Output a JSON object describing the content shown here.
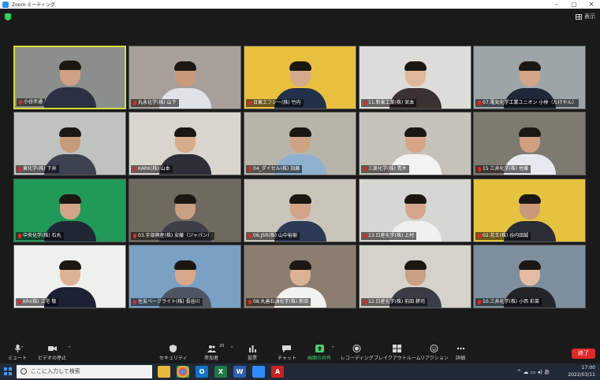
{
  "window": {
    "title": "Zoom ミーティング"
  },
  "view_button": {
    "label": "表示"
  },
  "participants": [
    {
      "name": "小谷幸通",
      "active": true,
      "bg": "#8a8f8d",
      "shirt": "#2a3142",
      "skin": "#cfa284"
    },
    {
      "name": "丸永化学(株) 山下",
      "bg": "#a7a09a",
      "shirt": "#dfe3e8",
      "skin": "#c99a7a"
    },
    {
      "name": "日東エフシー(株) 竹内",
      "bg": "#e8c03e",
      "shirt": "#23304a",
      "skin": "#d4a98c"
    },
    {
      "name": "11.新東工業(株) 宮本",
      "bg": "#dcdcd8",
      "shirt": "#3a3230",
      "skin": "#e0b79b"
    },
    {
      "name": "07.電気化学工業ユニオン 小林（たけやん）",
      "bg": "#9ea5a8",
      "shirt": "#1f2838",
      "skin": "#d3a688"
    },
    {
      "name": "東化学(株) 下井",
      "bg": "#bfc3c0",
      "shirt": "#3d4250",
      "skin": "#c99a7a"
    },
    {
      "name": "KARK(株) 山本",
      "bg": "#d9d4cc",
      "shirt": "#2c2f38",
      "skin": "#d8ab8a"
    },
    {
      "name": "04_ダイセル(株) 加藤",
      "bg": "#b9b4aa",
      "shirt": "#8fb1cf",
      "skin": "#d0a285"
    },
    {
      "name": "三菱化学(株) 青木",
      "bg": "#c5c2ba",
      "shirt": "#f3f3f3",
      "skin": "#d6a587"
    },
    {
      "name": "15 三井化学(株) 佐藤",
      "bg": "#7d7a70",
      "shirt": "#e7e9f0",
      "skin": "#cf9f80"
    },
    {
      "name": "中央化学(株) 石丸",
      "bg": "#1f9a59",
      "shirt": "#1f2735",
      "skin": "#d3a586"
    },
    {
      "name": "03.宇部興産(株) 安藤（ジャパン）",
      "bg": "#6f6a60",
      "shirt": "#3c3f48",
      "skin": "#caa083"
    },
    {
      "name": "06.JSR(株) 山中裕樹",
      "bg": "#c9c5ba",
      "shirt": "#2c3a55",
      "skin": "#d3a586"
    },
    {
      "name": "13.日産化学(株) 上村",
      "bg": "#d6d6d2",
      "shirt": "#f0f0f0",
      "skin": "#d4a78a"
    },
    {
      "name": "02.花王(株) 谷内田誠",
      "bg": "#e6c33f",
      "shirt": "#2a2d36",
      "skin": "#c99a7a"
    },
    {
      "name": "KRI(株) 三宅 敬",
      "bg": "#eef0ee",
      "shirt": "#1c2233",
      "skin": "#dcb194"
    },
    {
      "name": "住友ベークライト(株) 長谷川",
      "bg": "#7aa0c4",
      "shirt": "#4e5561",
      "skin": "#d9a888"
    },
    {
      "name": "08.丸善石油化学(株) 新田",
      "bg": "#8a7e70",
      "shirt": "#f2f2ee",
      "skin": "#dcb294"
    },
    {
      "name": "12.日産化学(株) 前田 耕司",
      "bg": "#d4d2ca",
      "shirt": "#3a3d45",
      "skin": "#caa083"
    },
    {
      "name": "10.三井化学(株) 小西 彩菜",
      "bg": "#7d8f9d",
      "shirt": "#23242a",
      "skin": "#e3bca2"
    }
  ],
  "toolbar": {
    "mute": "ミュート",
    "video": "ビデオの停止",
    "security": "セキュリティ",
    "participants": "参加者",
    "participants_count": "20",
    "polls": "投票",
    "chat": "チャット",
    "share": "画面の共有",
    "record": "レコーディング",
    "breakout": "ブレイクアウトルーム",
    "reactions": "リアクション",
    "more": "詳細",
    "end": "終了"
  },
  "taskbar": {
    "search_placeholder": "ここに入力して検索",
    "time": "17:00",
    "date": "2022/03/11",
    "ime": "あ"
  }
}
